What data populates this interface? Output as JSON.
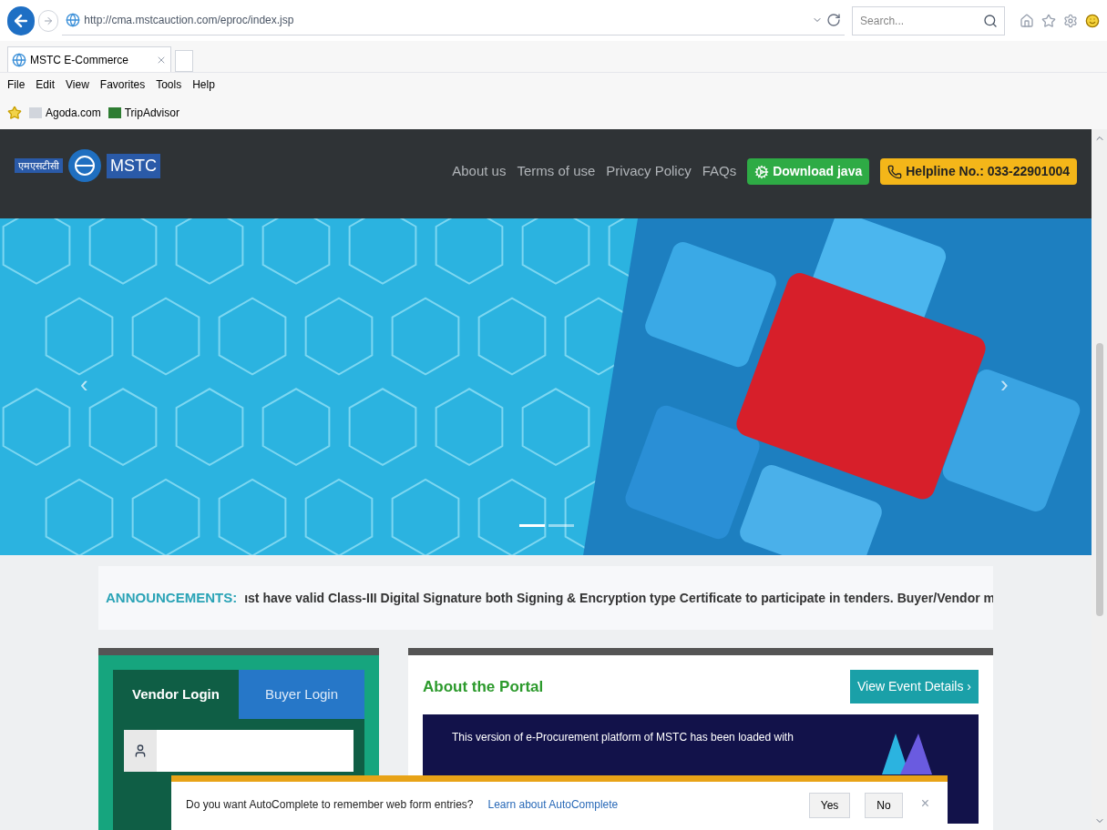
{
  "browser": {
    "address": "http://cma.mstcauction.com/eproc/index.jsp",
    "search": {
      "placeholder": "Search..."
    },
    "tabs": [
      {
        "label": "MSTC E-Commerce",
        "selected": true
      }
    ],
    "menu": [
      "File",
      "Edit",
      "View",
      "Favorites",
      "Tools",
      "Help"
    ],
    "favorites": [
      "Agoda.com",
      "TripAdvisor"
    ]
  },
  "header": {
    "logo_hindi": "एमएसटीसी",
    "logo": "MSTC",
    "nav": [
      "About us",
      "Terms of use",
      "Privacy Policy",
      "FAQs"
    ],
    "download": "Download java",
    "helpline": "Helpline No.: 033-22901004"
  },
  "carousel": {
    "prev": "‹",
    "next": "›",
    "slides": [
      {
        "selected": true
      },
      {
        "selected": false
      }
    ]
  },
  "announcement": {
    "label": "ANNOUNCEMENTS:",
    "text": "ıst have valid Class-III Digital Signature both Signing & Encryption type Certificate to participate in tenders.  Buyer/Vendor m"
  },
  "login": {
    "tabs": [
      {
        "label": "Vendor Login",
        "selected": true
      },
      {
        "label": "Buyer Login",
        "selected": false
      }
    ]
  },
  "portal": {
    "title": "About the Portal",
    "button": "View Event Details ›",
    "text": "This version of e-Procurement platform of MSTC has been loaded with"
  },
  "autocomplete": {
    "question": "Do you want AutoComplete to remember web form entries?",
    "link": "Learn about AutoComplete",
    "buttons": [
      "Yes",
      "No"
    ],
    "close": "×"
  }
}
